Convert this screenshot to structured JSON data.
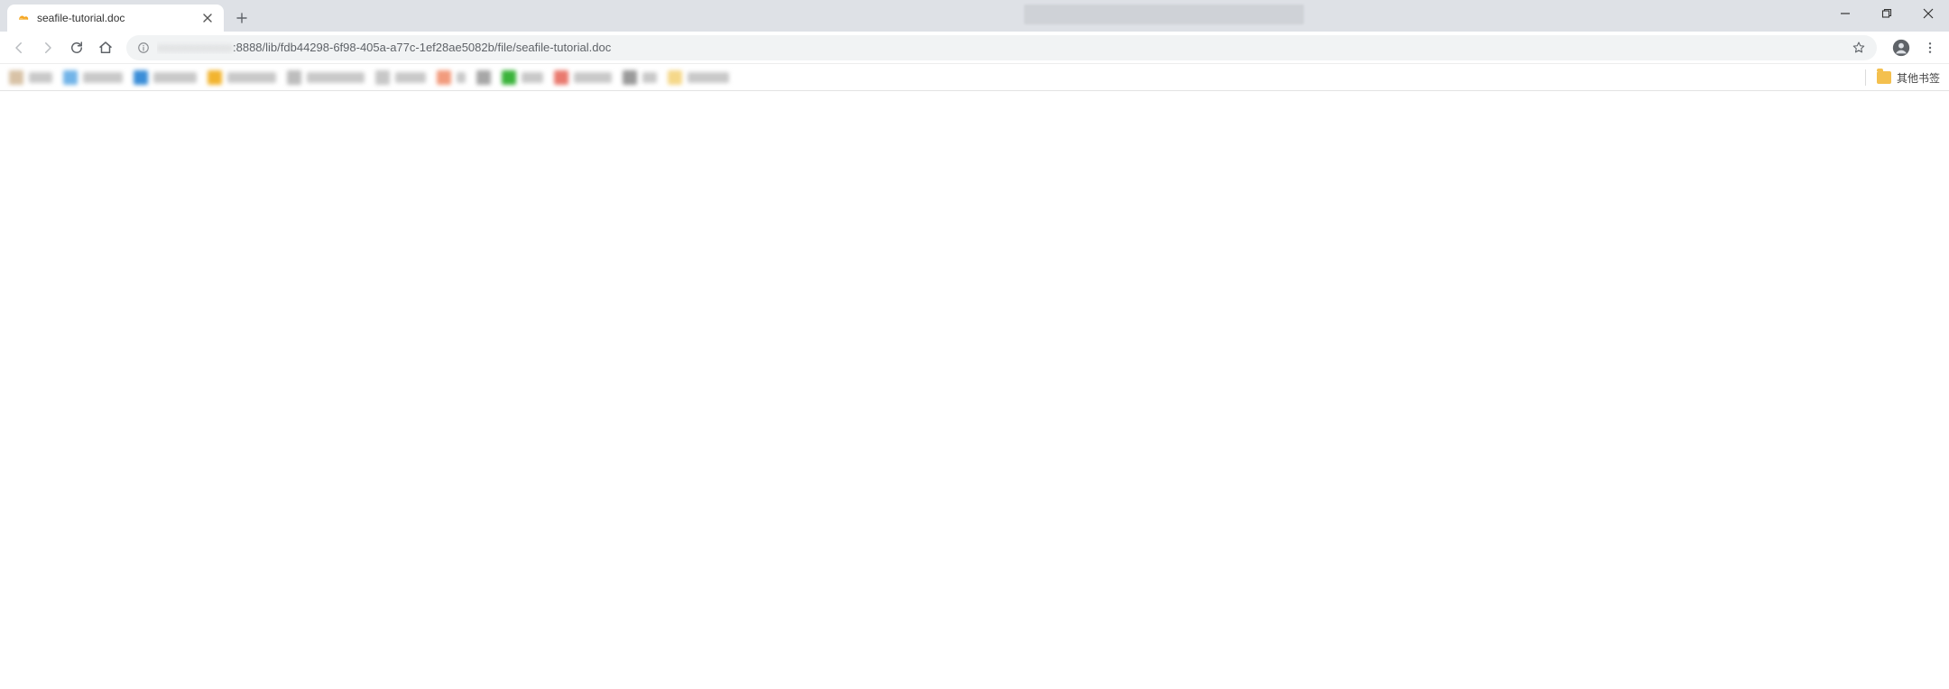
{
  "window": {
    "minimize_tooltip": "Minimize",
    "maximize_tooltip": "Restore",
    "close_tooltip": "Close"
  },
  "tabs": [
    {
      "title": "seafile-tutorial.doc",
      "favicon": "seafile-icon"
    }
  ],
  "new_tab_tooltip": "New tab",
  "toolbar": {
    "back_tooltip": "Back",
    "forward_tooltip": "Forward",
    "reload_tooltip": "Reload",
    "home_tooltip": "Home",
    "site_info_tooltip": "View site information",
    "url_obscured_prefix": "xxxxxxxxxxxx",
    "url_visible": ":8888/lib/fdb44298-6f98-405a-a77c-1ef28ae5082b/file/seafile-tutorial.doc",
    "star_tooltip": "Bookmark this page",
    "profile_tooltip": "You",
    "menu_tooltip": "Customize and control"
  },
  "bookmarks": {
    "items": [
      {
        "color": "#d8c2a6",
        "text_width": 26
      },
      {
        "color": "#72b4e8",
        "text_width": 44
      },
      {
        "color": "#3b8ed8",
        "text_width": 48
      },
      {
        "color": "#f2b42f",
        "text_width": 54
      },
      {
        "color": "#bdbdbd",
        "text_width": 64
      },
      {
        "color": "#c7c7c7",
        "text_width": 34
      },
      {
        "color": "#f29b7d",
        "text_width": 10
      },
      {
        "color": "#a7a7a7",
        "text_width": 0
      },
      {
        "color": "#3bb33b",
        "text_width": 24
      },
      {
        "color": "#e97a6f",
        "text_width": 42
      },
      {
        "color": "#9a9a9a",
        "text_width": 16
      },
      {
        "color": "#f5d88a",
        "text_width": 46
      }
    ],
    "other_label": "其他书签"
  }
}
